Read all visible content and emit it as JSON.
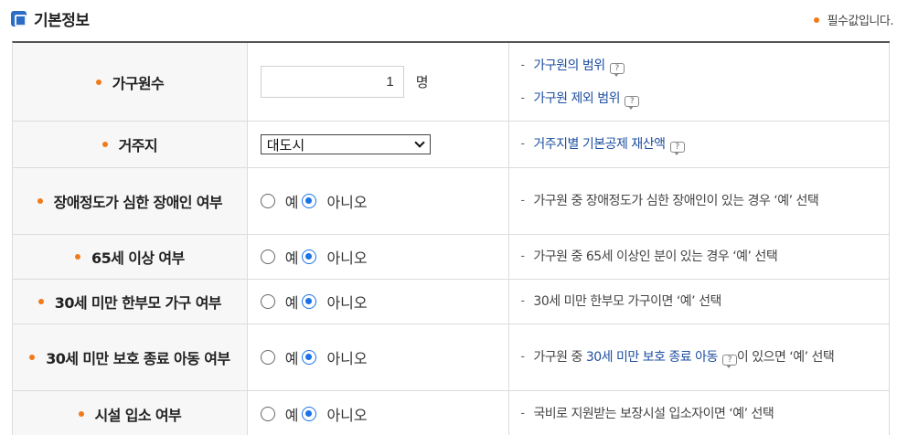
{
  "header": {
    "title": "기본정보",
    "required_note": "필수값입니다."
  },
  "colors": {
    "bullet": "#f07b1a",
    "link": "#1e4fa0",
    "radio_selected": "#1a73e8"
  },
  "rows": [
    {
      "label": "가구원수",
      "input_value": "1",
      "unit": "명",
      "info": [
        {
          "text": "가구원의 범위",
          "icon": "help-tooltip-icon"
        },
        {
          "text": "가구원 제외 범위",
          "icon": "help-tooltip-icon"
        }
      ]
    },
    {
      "label": "거주지",
      "select_value": "대도시",
      "info": [
        {
          "text": "거주지별 기본공제 재산액",
          "icon": "help-tooltip-icon"
        }
      ]
    },
    {
      "label": "장애정도가 심한 장애인 여부",
      "yes": "예",
      "no": "아니오",
      "selected": "아니오",
      "info": "가구원 중 장애정도가 심한 장애인이 있는 경우 ‘예’ 선택"
    },
    {
      "label": "65세 이상 여부",
      "yes": "예",
      "no": "아니오",
      "selected": "아니오",
      "info": "가구원 중 65세 이상인 분이 있는 경우 ‘예’ 선택"
    },
    {
      "label": "30세 미만 한부모 가구 여부",
      "yes": "예",
      "no": "아니오",
      "selected": "아니오",
      "info": "30세 미만 한부모 가구이면 ‘예’ 선택"
    },
    {
      "label": "30세 미만 보호 종료 아동 여부",
      "yes": "예",
      "no": "아니오",
      "selected": "아니오",
      "info_prefix": "가구원 중 ",
      "info_link": "30세 미만 보호 종료 아동",
      "info_icon": "help-tooltip-icon",
      "info_suffix": "이 있으면 ‘예’ 선택"
    },
    {
      "label": "시설 입소 여부",
      "yes": "예",
      "no": "아니오",
      "selected": "아니오",
      "info": "국비로 지원받는 보장시설 입소자이면 ‘예’ 선택"
    }
  ]
}
